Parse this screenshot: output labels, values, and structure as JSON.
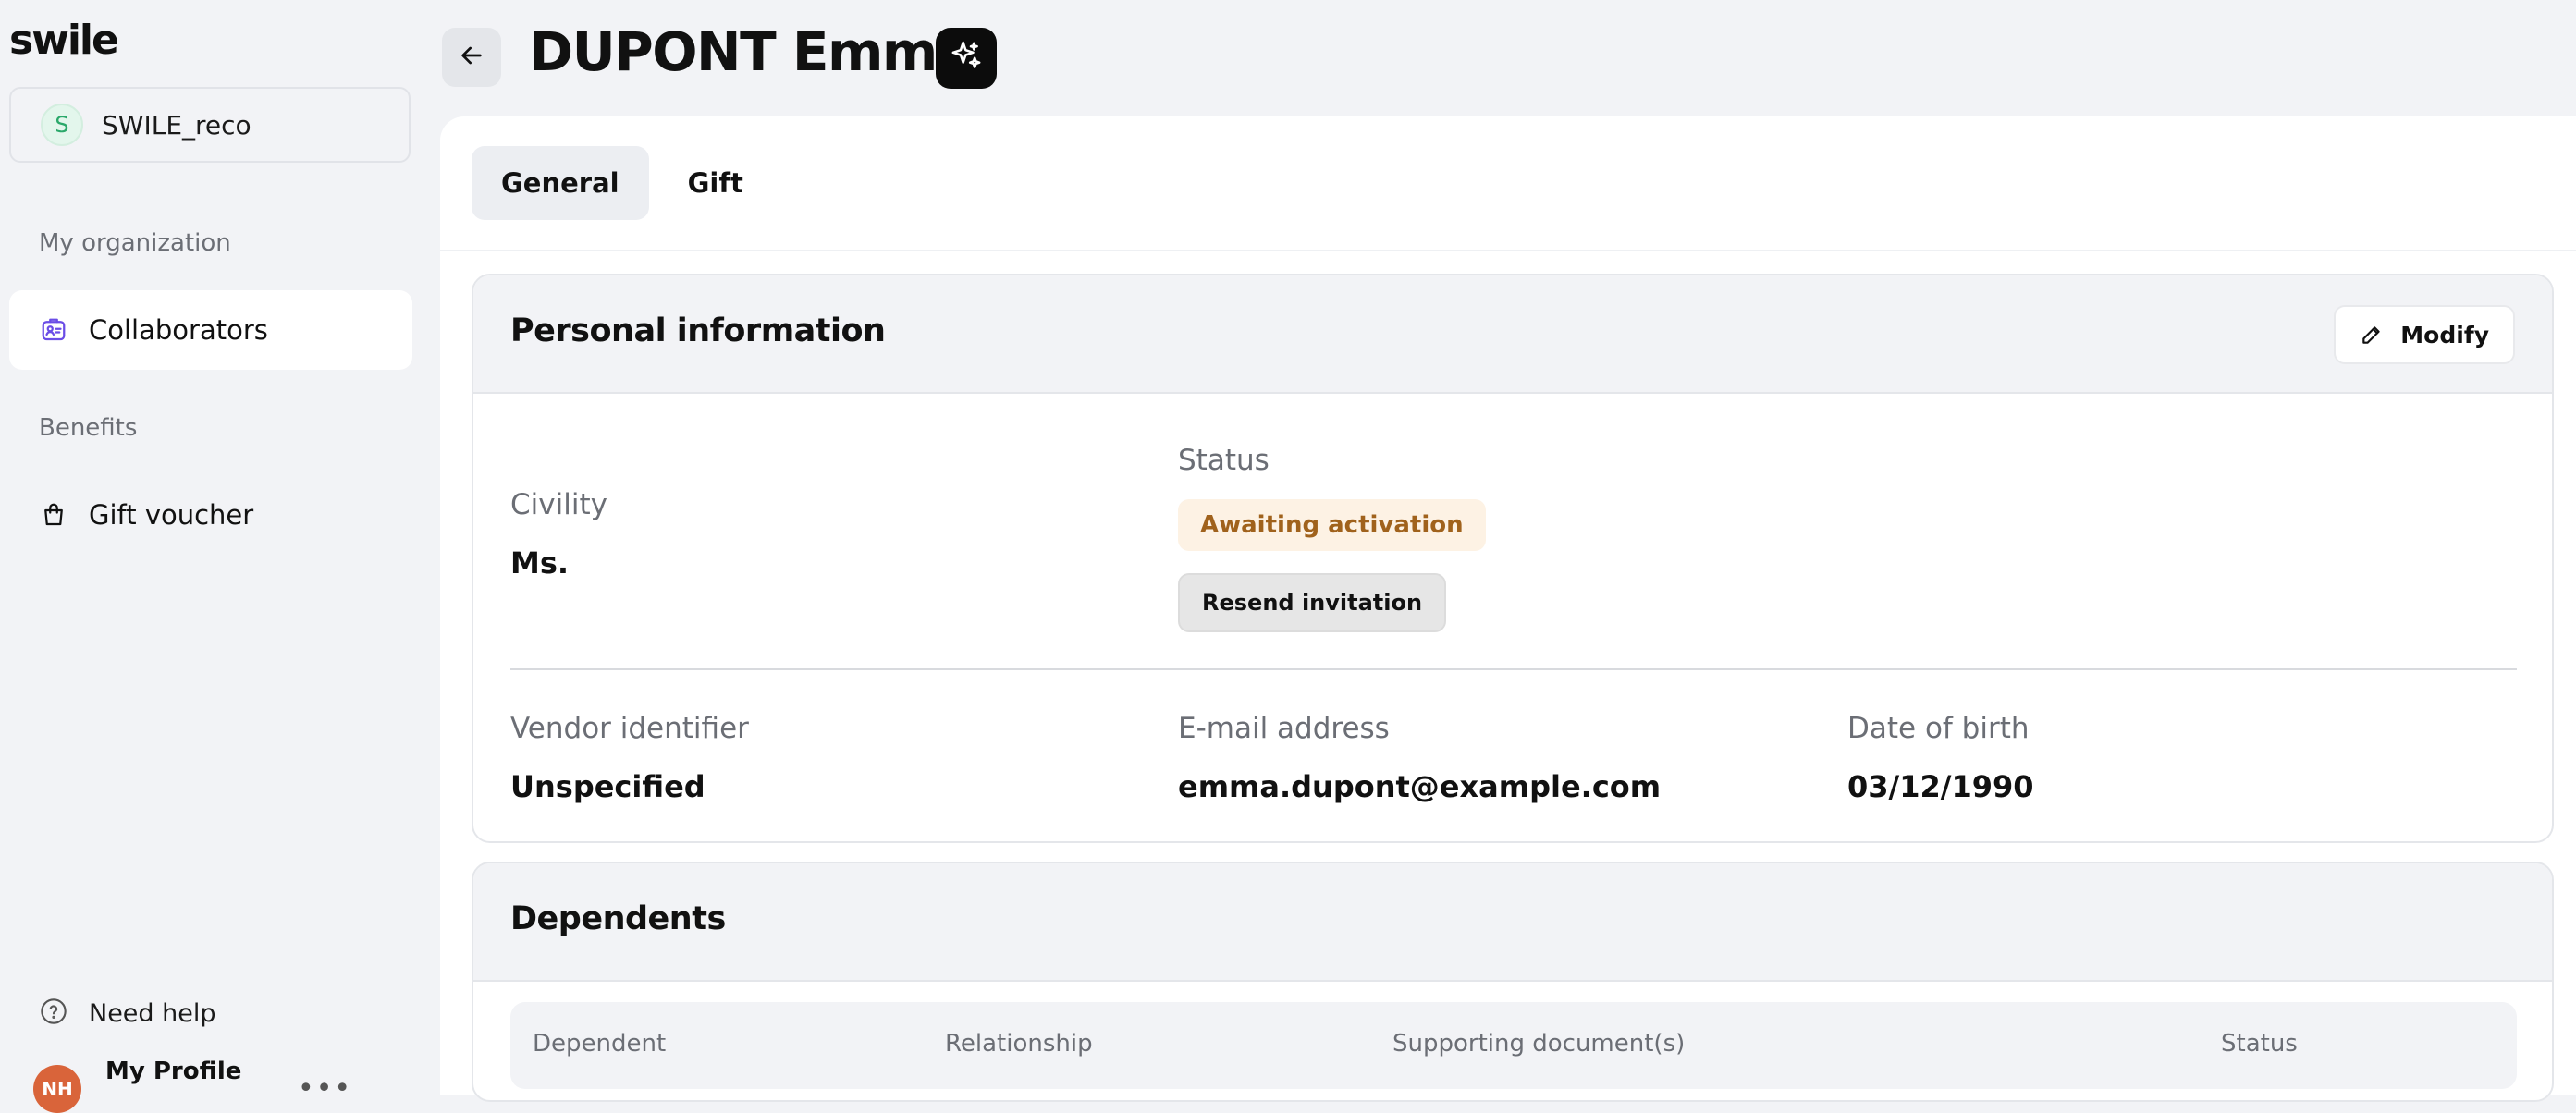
{
  "sidebar": {
    "logo": "swile",
    "org": {
      "initial": "S",
      "name": "SWILE_reco"
    },
    "sections": [
      {
        "label": "My organization",
        "items": [
          {
            "label": "Collaborators",
            "icon": "id-card-icon",
            "active": true
          }
        ]
      },
      {
        "label": "Benefits",
        "items": [
          {
            "label": "Gift voucher",
            "icon": "shopping-bag-icon",
            "active": false
          }
        ]
      }
    ],
    "help_label": "Need help",
    "profile": {
      "initials": "NH",
      "name": "My Profile"
    }
  },
  "header": {
    "title": "DUPONT Emma"
  },
  "tabs": [
    {
      "label": "General",
      "active": true
    },
    {
      "label": "Gift",
      "active": false
    }
  ],
  "personal_info": {
    "title": "Personal information",
    "modify_label": "Modify",
    "civility": {
      "label": "Civility",
      "value": "Ms."
    },
    "status": {
      "label": "Status",
      "badge": "Awaiting activation",
      "action": "Resend invitation"
    },
    "vendor": {
      "label": "Vendor identifier",
      "value": "Unspecified"
    },
    "email": {
      "label": "E-mail address",
      "value": "emma.dupont@example.com"
    },
    "dob": {
      "label": "Date of birth",
      "value": "03/12/1990"
    }
  },
  "dependents": {
    "title": "Dependents",
    "columns": [
      "Dependent",
      "Relationship",
      "Supporting document(s)",
      "Status"
    ]
  },
  "colors": {
    "status_badge_bg": "#fdf2e4",
    "status_badge_text": "#a0621c",
    "accent_purple": "#6b4de6"
  }
}
